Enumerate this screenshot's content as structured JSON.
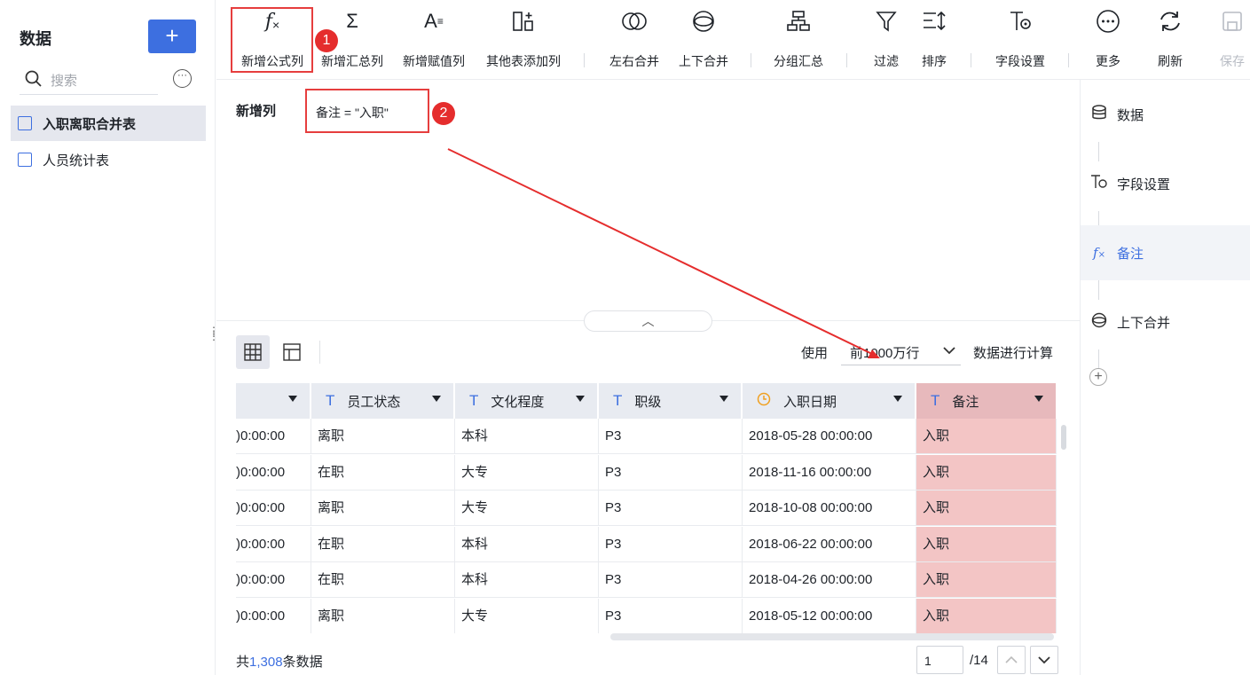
{
  "sidebar": {
    "title": "数据",
    "add_label": "+",
    "search_placeholder": "搜索",
    "items": [
      {
        "label": "入职离职合并表",
        "selected": true
      },
      {
        "label": "人员统计表",
        "selected": false
      }
    ]
  },
  "toolbar": {
    "items": [
      {
        "label": "新增公式列",
        "icon": "fx-icon"
      },
      {
        "label": "新增汇总列",
        "icon": "sigma-icon"
      },
      {
        "label": "新增赋值列",
        "icon": "assign-icon"
      },
      {
        "label": "其他表添加列",
        "icon": "add-column-icon"
      },
      {
        "label": "左右合并",
        "icon": "join-horizontal-icon"
      },
      {
        "label": "上下合并",
        "icon": "join-vertical-icon"
      },
      {
        "label": "分组汇总",
        "icon": "group-summary-icon"
      },
      {
        "label": "过滤",
        "icon": "filter-icon"
      },
      {
        "label": "排序",
        "icon": "sort-icon"
      },
      {
        "label": "字段设置",
        "icon": "field-settings-icon"
      },
      {
        "label": "更多",
        "icon": "more-icon"
      },
      {
        "label": "刷新",
        "icon": "refresh-icon"
      },
      {
        "label": "保存",
        "icon": "save-icon",
        "disabled": true
      }
    ]
  },
  "annotations": {
    "badge1": "1",
    "badge2": "2"
  },
  "formula": {
    "label": "新增列",
    "expression": "备注 = \"入职\""
  },
  "data_view": {
    "use_label": "使用",
    "row_limit": "前1000万行",
    "calc_label": "数据进行计算",
    "columns": [
      "",
      "员工状态",
      "文化程度",
      "职级",
      "入职日期",
      "备注"
    ],
    "rows": [
      [
        ")0:00:00",
        "离职",
        "本科",
        "P3",
        "2018-05-28 00:00:00",
        "入职"
      ],
      [
        ")0:00:00",
        "在职",
        "大专",
        "P3",
        "2018-11-16 00:00:00",
        "入职"
      ],
      [
        ")0:00:00",
        "离职",
        "大专",
        "P3",
        "2018-10-08 00:00:00",
        "入职"
      ],
      [
        ")0:00:00",
        "在职",
        "本科",
        "P3",
        "2018-06-22 00:00:00",
        "入职"
      ],
      [
        ")0:00:00",
        "在职",
        "本科",
        "P3",
        "2018-04-26 00:00:00",
        "入职"
      ],
      [
        ")0:00:00",
        "离职",
        "大专",
        "P3",
        "2018-05-12 00:00:00",
        "入职"
      ]
    ],
    "total_prefix": "共",
    "total_count": "1,308",
    "total_suffix": "条数据",
    "page_current": "1",
    "page_total": "/14"
  },
  "steps": [
    {
      "label": "数据",
      "icon": "database-icon"
    },
    {
      "label": "字段设置",
      "icon": "field-settings-icon"
    },
    {
      "label": "备注",
      "icon": "fx-icon",
      "selected": true
    },
    {
      "label": "上下合并",
      "icon": "join-vertical-icon"
    }
  ],
  "colors": {
    "accent": "#3d6fe0",
    "highlight": "#e63e3e",
    "pink": "#f3c5c5"
  }
}
